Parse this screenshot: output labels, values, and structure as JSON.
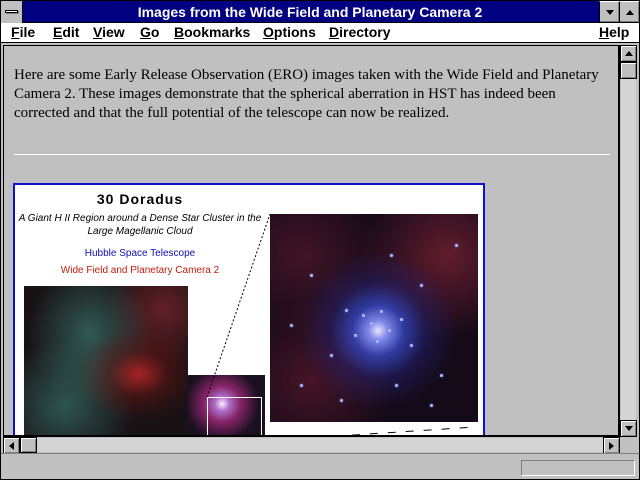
{
  "window": {
    "title": "Images from the Wide Field and Planetary Camera 2"
  },
  "menu": {
    "file": "File",
    "edit": "Edit",
    "view": "View",
    "go": "Go",
    "bookmarks": "Bookmarks",
    "options": "Options",
    "directory": "Directory",
    "help": "Help"
  },
  "page": {
    "intro": "Here are some Early Release Observation (ERO) images taken with the Wide Field and Planetary Camera 2. These images demonstrate that the spherical aberration in HST has indeed been corrected and that the full potential of the telescope can now be realized."
  },
  "figure": {
    "title": "30 Doradus",
    "subtitle": "A Giant H II Region around a Dense Star Cluster in the Large Magellanic Cloud",
    "telescope": "Hubble Space Telescope",
    "camera": "Wide Field and Planetary Camera 2"
  },
  "status": {
    "text": ""
  },
  "colors": {
    "titlebar": "#000080",
    "figure_border": "#1010d0",
    "telescope_text": "#1010b0",
    "camera_text": "#c02010"
  }
}
